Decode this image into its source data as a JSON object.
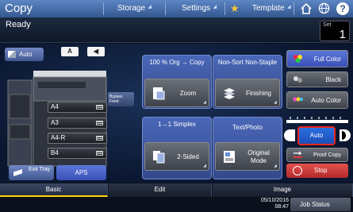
{
  "header": {
    "title": "Copy",
    "storage": "Storage",
    "settings": "Settings",
    "template": "Template"
  },
  "status": {
    "text": "Ready",
    "set_label": "Set",
    "set_value": "1"
  },
  "left_panel": {
    "auto_label": "Auto",
    "orient_a": "A",
    "orient_b": "◀",
    "bypass_label": "Bypass Feed",
    "trays": [
      {
        "label": "A4"
      },
      {
        "label": "A3"
      },
      {
        "label": "A4-R"
      },
      {
        "label": "B4"
      }
    ],
    "exit_tray_label": "Exit Tray",
    "aps_label": "APS"
  },
  "center": {
    "zoom_header": "100 % Org → Copy",
    "zoom_label": "Zoom",
    "finishing_header": "Non-Sort Non-Staple",
    "finishing_label": "Finishing",
    "sided_header": "1→1 Simplex",
    "sided_label": "2-Sided",
    "mode_header": "Text/Photo",
    "mode_label": "Original Mode"
  },
  "right_panel": {
    "full_color": "Full Color",
    "black": "Black",
    "auto_color": "Auto Color",
    "density_auto": "Auto",
    "proof_copy": "Proof Copy",
    "stop": "Stop"
  },
  "tabs": [
    "Basic",
    "Edit",
    "Image"
  ],
  "footer": {
    "date": "05/10/2016",
    "time": "08:47",
    "job_status": "Job Status"
  },
  "colors": {
    "accent_blue": "#34578f",
    "stop_red": "#d0403c",
    "active_tab_underline": "#ffd400"
  }
}
